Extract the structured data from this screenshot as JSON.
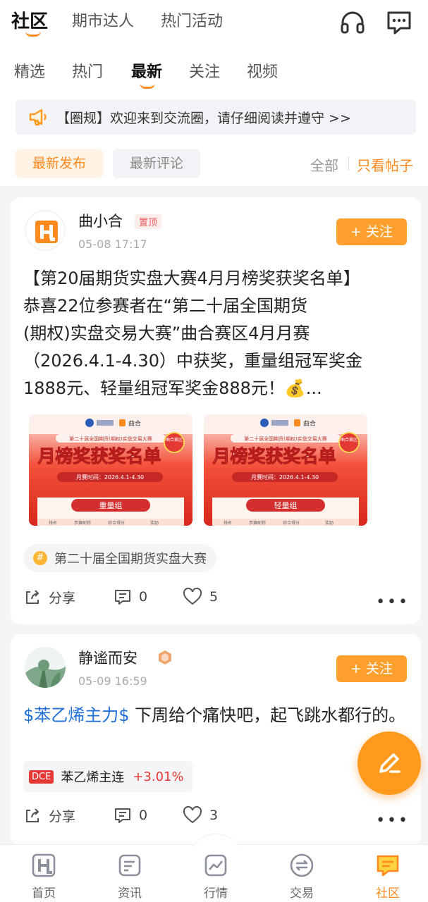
{
  "header": {
    "tabs": [
      "社区",
      "期市达人",
      "热门活动"
    ],
    "active_tab": "社区",
    "icons": [
      "headset-icon",
      "message-icon"
    ]
  },
  "subtabs": {
    "items": [
      "精选",
      "热门",
      "最新",
      "关注",
      "视频"
    ],
    "active": "最新"
  },
  "notice": {
    "text": "【圈规】欢迎来到交流圈，请仔细阅读并遵守 >>"
  },
  "filters": {
    "sort": [
      "最新发布",
      "最新评论"
    ],
    "active_sort": "最新发布",
    "scope": [
      "全部",
      "只看帖子"
    ],
    "active_scope": "只看帖子"
  },
  "posts": [
    {
      "user": "曲小合",
      "badge": "置顶",
      "time": "05-08 17:17",
      "follow_label": "+ 关注",
      "content_lines": [
        "【第20届期货实盘大赛4月月榜奖获奖名单】",
        "恭喜22位参赛者在“第二十届全国期货",
        "(期权)实盘交易大赛”曲合赛区4月月赛",
        "（2026.4.1-4.30）中获奖，重量组冠军奖金",
        "1888元、轻量组冠军奖金888元！💰..."
      ],
      "images": [
        {
          "title": "月榜奖获奖名单",
          "subtitle": "第二十届全国期货(期权)实盘交易大赛",
          "date": "月赛时间：2026.4.1-4.30",
          "group": "重量组",
          "cols": [
            "排名",
            "参赛昵称",
            "综合得分",
            "奖励"
          ],
          "tag": "曲合赛区",
          "brand": "曲合"
        },
        {
          "title": "月榜奖获奖名单",
          "subtitle": "第二十届全国期货(期权)实盘交易大赛",
          "date": "月赛时间：2026.4.1-4.30",
          "group": "轻量组",
          "cols": [
            "排名",
            "参赛昵称",
            "综合得分",
            "奖励"
          ],
          "tag": "曲合赛区",
          "brand": "曲合"
        }
      ],
      "topic": "第二十届全国期货实盘大赛",
      "share_label": "分享",
      "comments": "0",
      "likes": "5"
    },
    {
      "user": "静谧而安",
      "time": "05-09 16:59",
      "follow_label": "+ 关注",
      "stock_tag": "$苯乙烯主力$",
      "content": " 下周给个痛快吧，起飞跳水都行的。",
      "quote": {
        "exchange": "DCE",
        "name": "苯乙烯主连",
        "change": "+3.01%"
      },
      "share_label": "分享",
      "comments": "0",
      "likes": "3"
    }
  ],
  "bottom_nav": {
    "items": [
      "首页",
      "资讯",
      "行情",
      "交易",
      "社区"
    ],
    "active": "社区"
  },
  "colors": {
    "accent": "#ff8a1f",
    "follow": "#ffa02e",
    "rise": "#e53935",
    "link": "#1f6fd6"
  }
}
